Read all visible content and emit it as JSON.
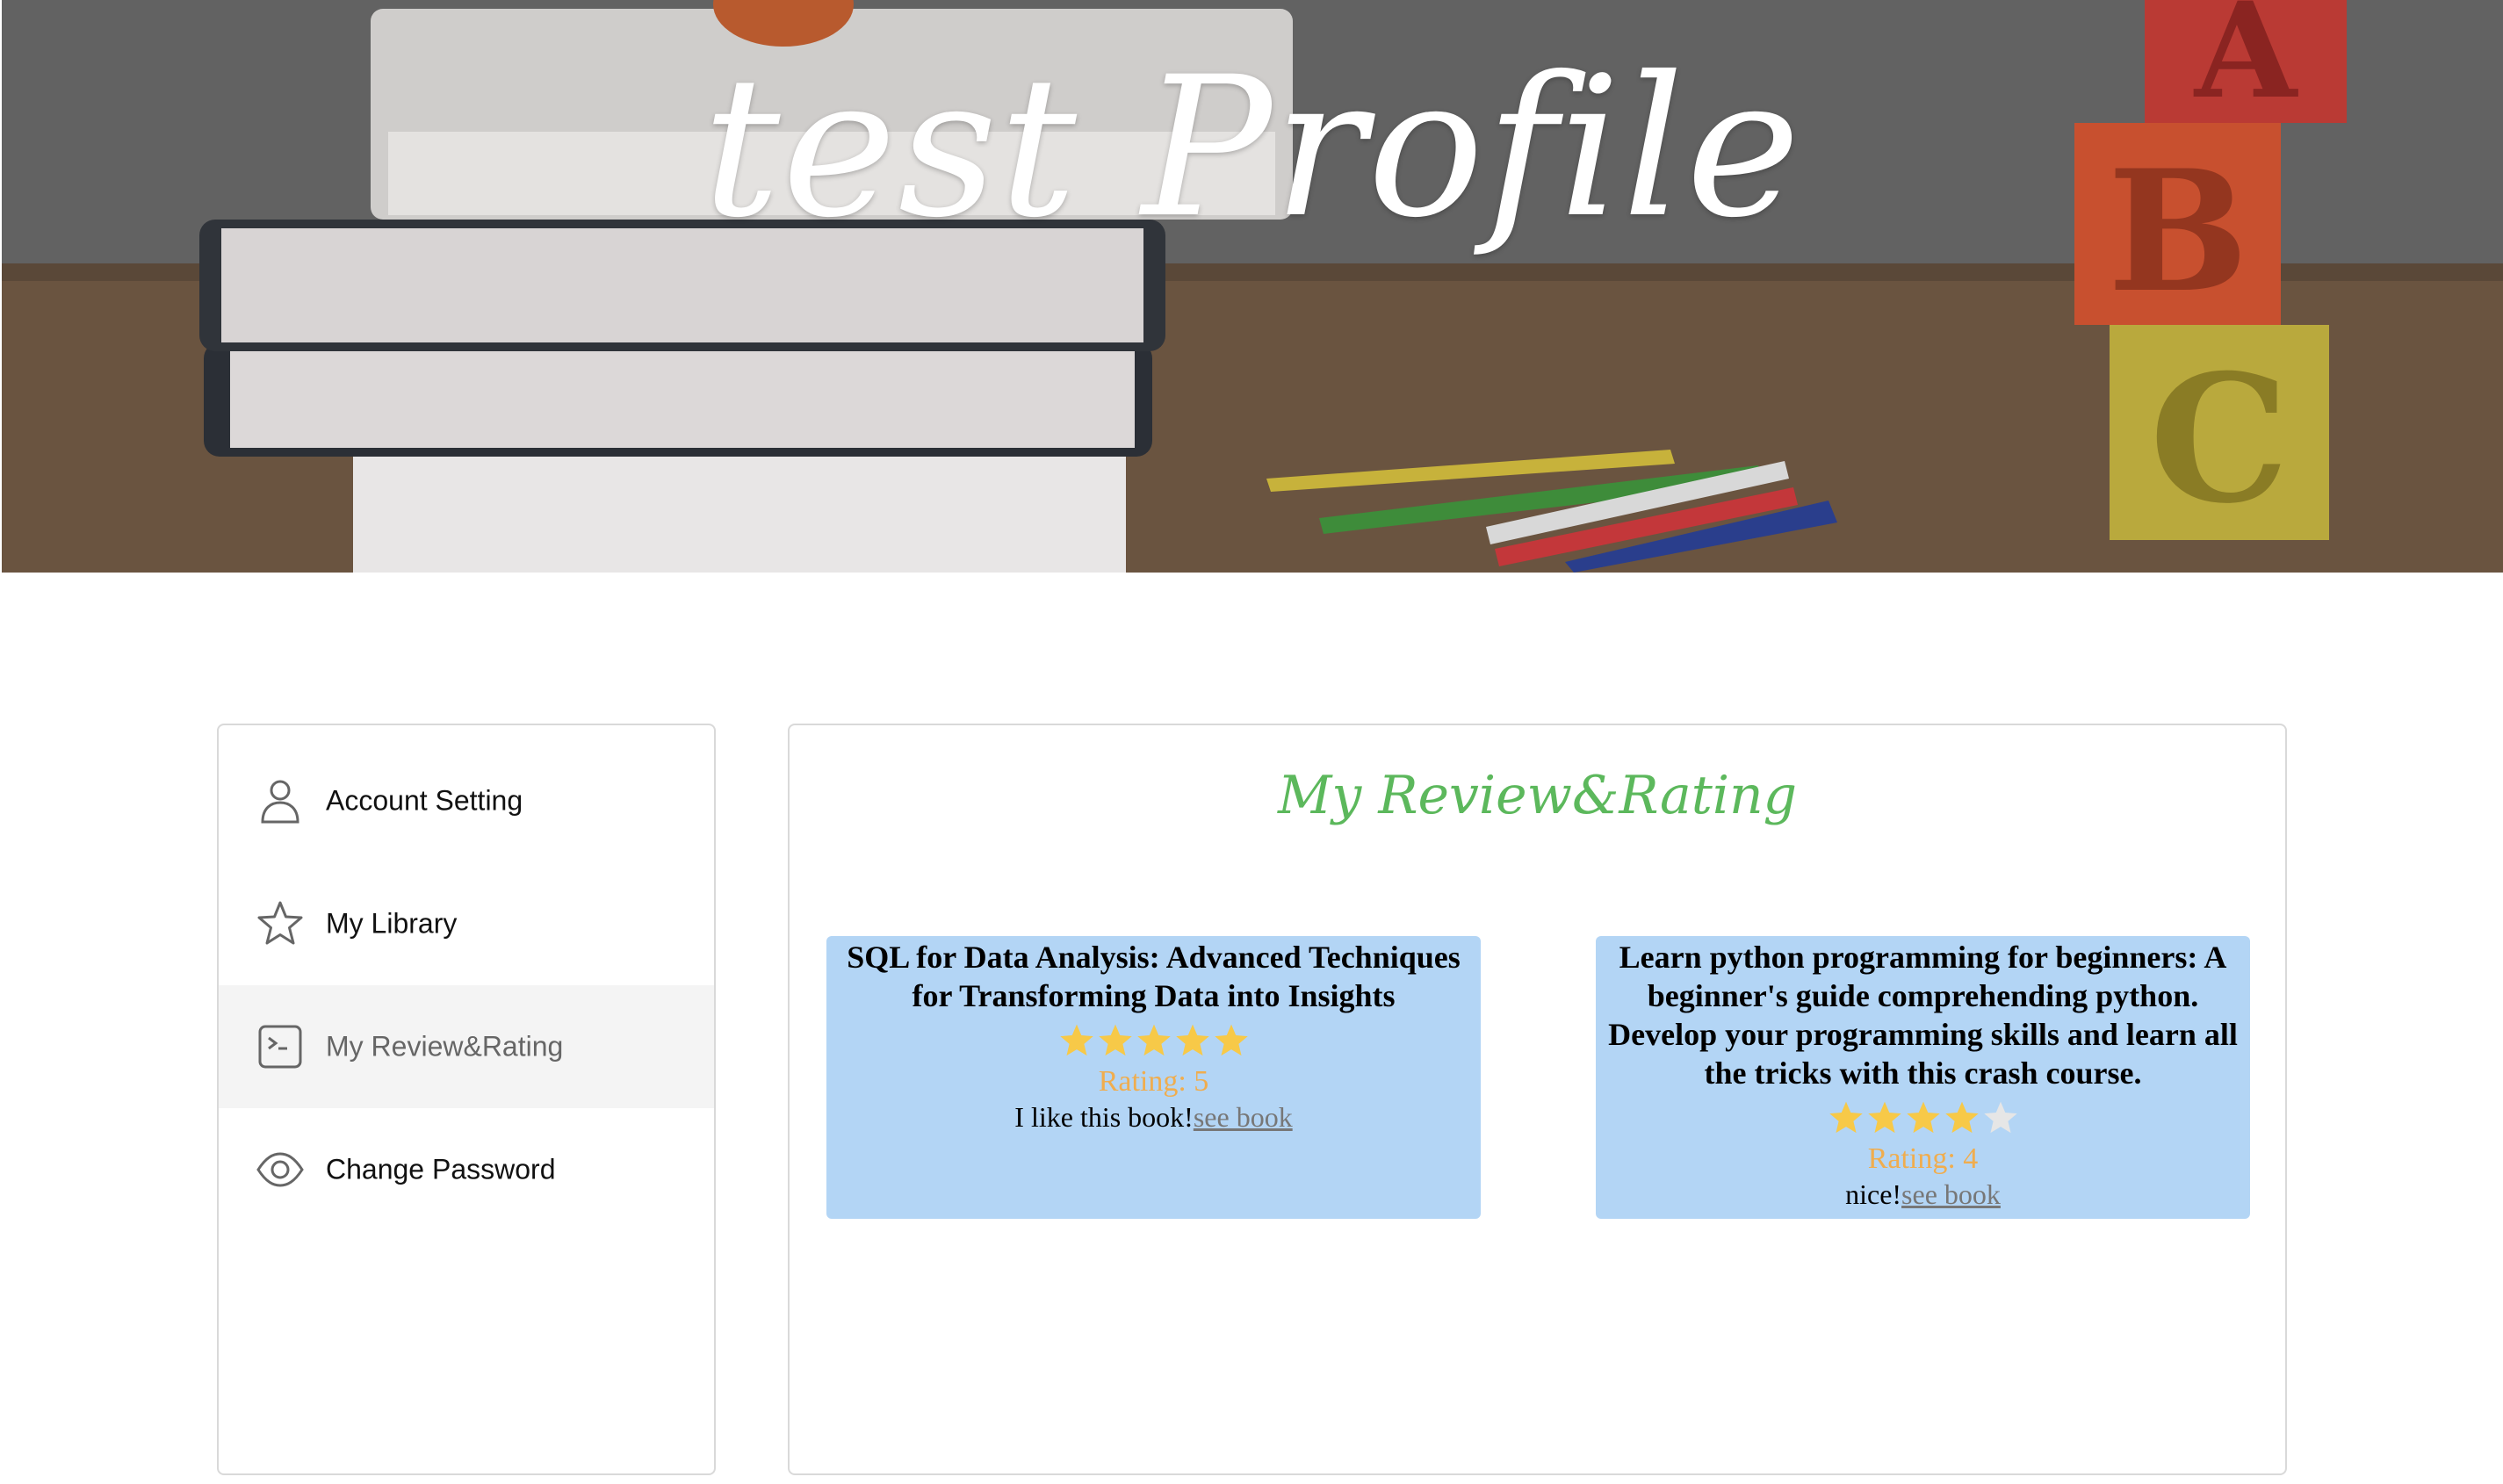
{
  "banner": {
    "title": "test Profile"
  },
  "sidebar": {
    "items": [
      {
        "label": "Account Setting",
        "icon": "user-icon",
        "active": false
      },
      {
        "label": "My Library",
        "icon": "star-outline-icon",
        "active": false
      },
      {
        "label": "My Review&Rating",
        "icon": "terminal-icon",
        "active": true
      },
      {
        "label": "Change Password",
        "icon": "eye-icon",
        "active": false
      }
    ]
  },
  "main": {
    "title": "My Review&Rating",
    "reviews": [
      {
        "book_title": "SQL for Data Analysis: Advanced Techniques for Transforming Data into Insights",
        "stars": 5,
        "rating_text": "Rating: 5",
        "comment": "I like this book!",
        "link_label": "see book"
      },
      {
        "book_title": "Learn python programming for beginners: A beginner's guide comprehending python. Develop your programming skills and learn all the tricks with this crash course.",
        "stars": 4,
        "rating_text": "Rating: 4",
        "comment": "nice!",
        "link_label": "see book"
      }
    ]
  },
  "colors": {
    "accent_green": "#5cb85c",
    "card_bg": "#b3d5f5",
    "star_filled": "#f7c948",
    "star_empty": "#e6e6e6",
    "rating_text": "#f0ad4e"
  }
}
